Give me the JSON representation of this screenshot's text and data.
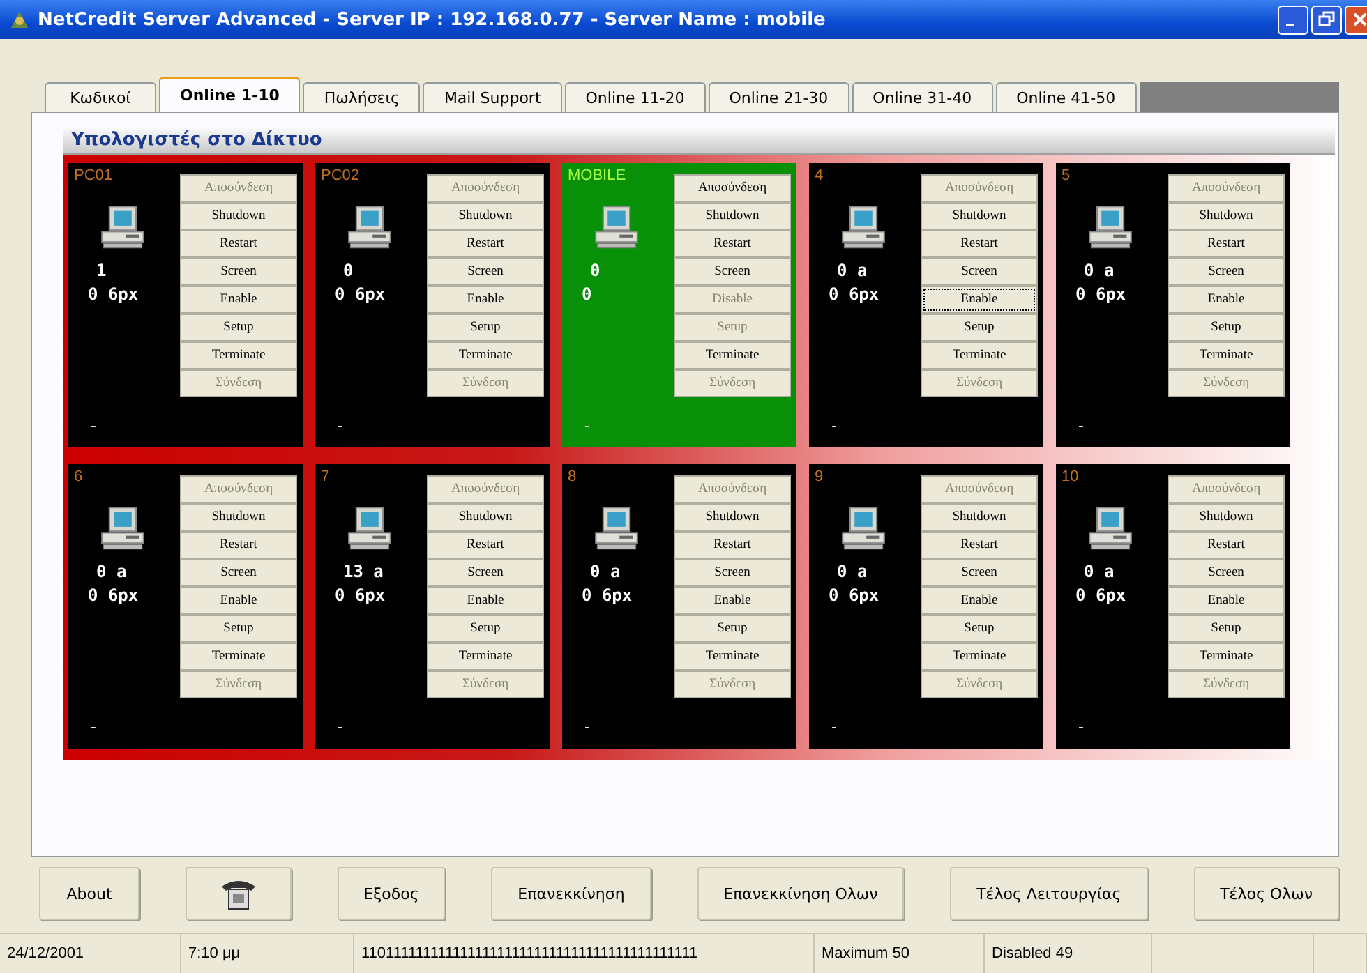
{
  "window": {
    "title": "NetCredit Server Advanced  - Server IP : 192.168.0.77 - Server Name : mobile"
  },
  "tabs": [
    {
      "label": "Κωδικοί",
      "selected": false
    },
    {
      "label": "Online 1-10",
      "selected": true
    },
    {
      "label": "Πωλήσεις",
      "selected": false
    },
    {
      "label": "Mail Support",
      "selected": false
    },
    {
      "label": "Online 11-20",
      "selected": false
    },
    {
      "label": "Online 21-30",
      "selected": false
    },
    {
      "label": "Online 31-40",
      "selected": false
    },
    {
      "label": "Online 41-50",
      "selected": false
    }
  ],
  "group_title": "Υπολογιστές στο Δίκτυο",
  "computers": [
    {
      "name": "PC01",
      "online": false,
      "line1": "1",
      "line2": "0 6px",
      "status": "-",
      "buttons": [
        {
          "label": "Αποσύνδεση",
          "disabled": true,
          "focused": false
        },
        {
          "label": "Shutdown",
          "disabled": false,
          "focused": false
        },
        {
          "label": "Restart",
          "disabled": false,
          "focused": false
        },
        {
          "label": "Screen",
          "disabled": false,
          "focused": false
        },
        {
          "label": "Enable",
          "disabled": false,
          "focused": false
        },
        {
          "label": "Setup",
          "disabled": false,
          "focused": false
        },
        {
          "label": "Terminate",
          "disabled": false,
          "focused": false
        },
        {
          "label": "Σύνδεση",
          "disabled": true,
          "focused": false
        }
      ]
    },
    {
      "name": "PC02",
      "online": false,
      "line1": "0",
      "line2": "0 6px",
      "status": "-",
      "buttons": [
        {
          "label": "Αποσύνδεση",
          "disabled": true,
          "focused": false
        },
        {
          "label": "Shutdown",
          "disabled": false,
          "focused": false
        },
        {
          "label": "Restart",
          "disabled": false,
          "focused": false
        },
        {
          "label": "Screen",
          "disabled": false,
          "focused": false
        },
        {
          "label": "Enable",
          "disabled": false,
          "focused": false
        },
        {
          "label": "Setup",
          "disabled": false,
          "focused": false
        },
        {
          "label": "Terminate",
          "disabled": false,
          "focused": false
        },
        {
          "label": "Σύνδεση",
          "disabled": true,
          "focused": false
        }
      ]
    },
    {
      "name": "MOBILE",
      "online": true,
      "line1": "0",
      "line2": "0",
      "status": "-",
      "buttons": [
        {
          "label": "Αποσύνδεση",
          "disabled": false,
          "focused": false
        },
        {
          "label": "Shutdown",
          "disabled": false,
          "focused": false
        },
        {
          "label": "Restart",
          "disabled": false,
          "focused": false
        },
        {
          "label": "Screen",
          "disabled": false,
          "focused": false
        },
        {
          "label": "Disable",
          "disabled": true,
          "focused": false
        },
        {
          "label": "Setup",
          "disabled": true,
          "focused": false
        },
        {
          "label": "Terminate",
          "disabled": false,
          "focused": false
        },
        {
          "label": "Σύνδεση",
          "disabled": true,
          "focused": false
        }
      ]
    },
    {
      "name": "4",
      "online": false,
      "line1": "0 a",
      "line2": "0 6px",
      "status": "-",
      "buttons": [
        {
          "label": "Αποσύνδεση",
          "disabled": true,
          "focused": false
        },
        {
          "label": "Shutdown",
          "disabled": false,
          "focused": false
        },
        {
          "label": "Restart",
          "disabled": false,
          "focused": false
        },
        {
          "label": "Screen",
          "disabled": false,
          "focused": false
        },
        {
          "label": "Enable",
          "disabled": false,
          "focused": true
        },
        {
          "label": "Setup",
          "disabled": false,
          "focused": false
        },
        {
          "label": "Terminate",
          "disabled": false,
          "focused": false
        },
        {
          "label": "Σύνδεση",
          "disabled": true,
          "focused": false
        }
      ]
    },
    {
      "name": "5",
      "online": false,
      "line1": "0 a",
      "line2": "0 6px",
      "status": "-",
      "buttons": [
        {
          "label": "Αποσύνδεση",
          "disabled": true,
          "focused": false
        },
        {
          "label": "Shutdown",
          "disabled": false,
          "focused": false
        },
        {
          "label": "Restart",
          "disabled": false,
          "focused": false
        },
        {
          "label": "Screen",
          "disabled": false,
          "focused": false
        },
        {
          "label": "Enable",
          "disabled": false,
          "focused": false
        },
        {
          "label": "Setup",
          "disabled": false,
          "focused": false
        },
        {
          "label": "Terminate",
          "disabled": false,
          "focused": false
        },
        {
          "label": "Σύνδεση",
          "disabled": true,
          "focused": false
        }
      ]
    },
    {
      "name": "6",
      "online": false,
      "line1": "0 a",
      "line2": "0 6px",
      "status": "-",
      "buttons": [
        {
          "label": "Αποσύνδεση",
          "disabled": true,
          "focused": false
        },
        {
          "label": "Shutdown",
          "disabled": false,
          "focused": false
        },
        {
          "label": "Restart",
          "disabled": false,
          "focused": false
        },
        {
          "label": "Screen",
          "disabled": false,
          "focused": false
        },
        {
          "label": "Enable",
          "disabled": false,
          "focused": false
        },
        {
          "label": "Setup",
          "disabled": false,
          "focused": false
        },
        {
          "label": "Terminate",
          "disabled": false,
          "focused": false
        },
        {
          "label": "Σύνδεση",
          "disabled": true,
          "focused": false
        }
      ]
    },
    {
      "name": "7",
      "online": false,
      "line1": "13 a",
      "line2": "0 6px",
      "status": "-",
      "buttons": [
        {
          "label": "Αποσύνδεση",
          "disabled": true,
          "focused": false
        },
        {
          "label": "Shutdown",
          "disabled": false,
          "focused": false
        },
        {
          "label": "Restart",
          "disabled": false,
          "focused": false
        },
        {
          "label": "Screen",
          "disabled": false,
          "focused": false
        },
        {
          "label": "Enable",
          "disabled": false,
          "focused": false
        },
        {
          "label": "Setup",
          "disabled": false,
          "focused": false
        },
        {
          "label": "Terminate",
          "disabled": false,
          "focused": false
        },
        {
          "label": "Σύνδεση",
          "disabled": true,
          "focused": false
        }
      ]
    },
    {
      "name": "8",
      "online": false,
      "line1": "0 a",
      "line2": "0 6px",
      "status": "-",
      "buttons": [
        {
          "label": "Αποσύνδεση",
          "disabled": true,
          "focused": false
        },
        {
          "label": "Shutdown",
          "disabled": false,
          "focused": false
        },
        {
          "label": "Restart",
          "disabled": false,
          "focused": false
        },
        {
          "label": "Screen",
          "disabled": false,
          "focused": false
        },
        {
          "label": "Enable",
          "disabled": false,
          "focused": false
        },
        {
          "label": "Setup",
          "disabled": false,
          "focused": false
        },
        {
          "label": "Terminate",
          "disabled": false,
          "focused": false
        },
        {
          "label": "Σύνδεση",
          "disabled": true,
          "focused": false
        }
      ]
    },
    {
      "name": "9",
      "online": false,
      "line1": "0 a",
      "line2": "0 6px",
      "status": "-",
      "buttons": [
        {
          "label": "Αποσύνδεση",
          "disabled": true,
          "focused": false
        },
        {
          "label": "Shutdown",
          "disabled": false,
          "focused": false
        },
        {
          "label": "Restart",
          "disabled": false,
          "focused": false
        },
        {
          "label": "Screen",
          "disabled": false,
          "focused": false
        },
        {
          "label": "Enable",
          "disabled": false,
          "focused": false
        },
        {
          "label": "Setup",
          "disabled": false,
          "focused": false
        },
        {
          "label": "Terminate",
          "disabled": false,
          "focused": false
        },
        {
          "label": "Σύνδεση",
          "disabled": true,
          "focused": false
        }
      ]
    },
    {
      "name": "10",
      "online": false,
      "line1": "0 a",
      "line2": "0 6px",
      "status": "-",
      "buttons": [
        {
          "label": "Αποσύνδεση",
          "disabled": true,
          "focused": false
        },
        {
          "label": "Shutdown",
          "disabled": false,
          "focused": false
        },
        {
          "label": "Restart",
          "disabled": false,
          "focused": false
        },
        {
          "label": "Screen",
          "disabled": false,
          "focused": false
        },
        {
          "label": "Enable",
          "disabled": false,
          "focused": false
        },
        {
          "label": "Setup",
          "disabled": false,
          "focused": false
        },
        {
          "label": "Terminate",
          "disabled": false,
          "focused": false
        },
        {
          "label": "Σύνδεση",
          "disabled": true,
          "focused": false
        }
      ]
    }
  ],
  "buttons": [
    {
      "kind": "text",
      "label": "About"
    },
    {
      "kind": "phone"
    },
    {
      "kind": "text",
      "label": "Εξοδος"
    },
    {
      "kind": "text",
      "label": "Επανεκκίνηση"
    },
    {
      "kind": "text",
      "label": "Επανεκκίνηση Ολων"
    },
    {
      "kind": "text",
      "label": "Τέλος Λειτουργίας"
    },
    {
      "kind": "text",
      "label": "Τέλος Ολων"
    }
  ],
  "status_bar": [
    "24/12/2001",
    "7:10 μμ",
    "110111111111111111111111111111111111111111111",
    "Maximum 50",
    "Disabled 49"
  ]
}
